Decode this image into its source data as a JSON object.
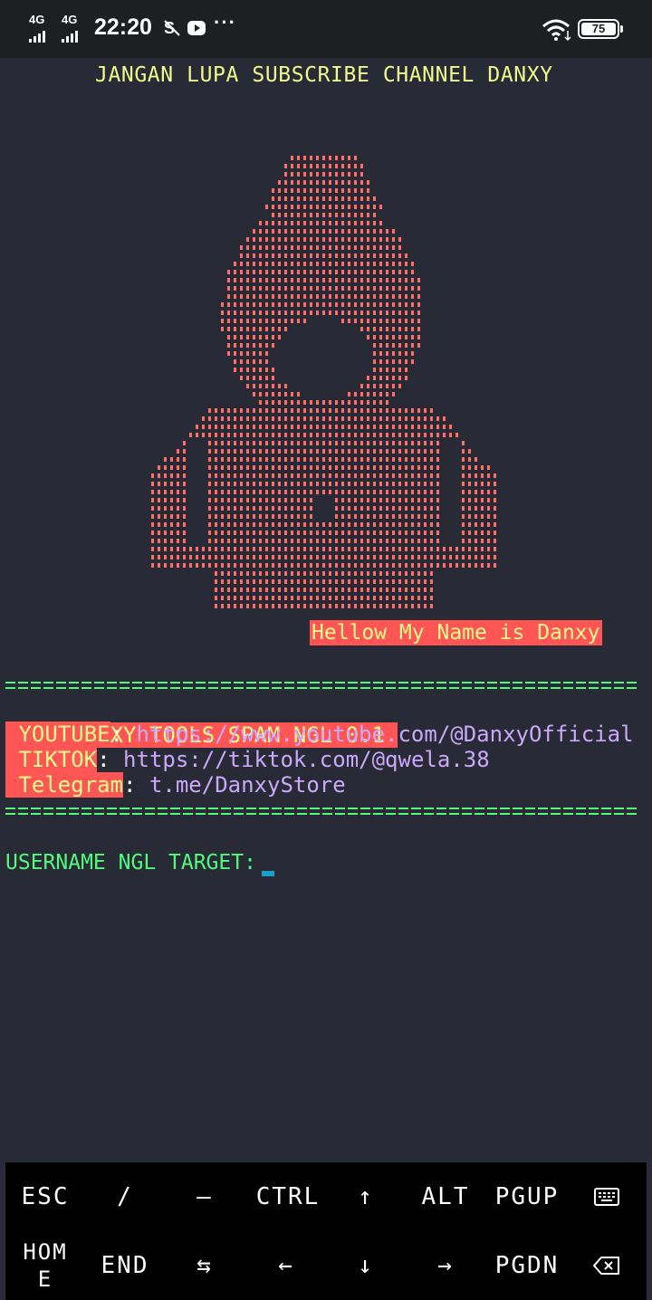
{
  "status_bar": {
    "network1": "4G",
    "network2": "4G",
    "time": "22:20",
    "more": "···",
    "battery": "75"
  },
  "terminal": {
    "banner": "JANGAN LUPA SUBSCRIBE CHANNEL DANXY",
    "hello": "Hellow My Name is Danxy",
    "tool_title": " DANXY TOOLS SPAM NGL 0.1 ",
    "youtube_label": " YOUTUBE",
    "youtube_url": " https://www.youtube.com/@DanxyOfficial",
    "tiktok_label": " TIKTOK",
    "tiktok_url": " https://tiktok.com/@qwela.38",
    "telegram_label": " Telegram",
    "telegram_url": " t.me/DanxyStore",
    "colon": ":",
    "prompt": "USERNAME NGL TARGET:"
  },
  "colors": {
    "background": "#282a36",
    "art": "#ff6e67",
    "highlight": "#ff5555",
    "yellow": "#f1fa8c",
    "green": "#50fa7b",
    "purple": "#caa9fa",
    "cursor": "#1aa0c8"
  },
  "extra_keys": {
    "row1": [
      "ESC",
      "/",
      "—",
      "CTRL",
      "↑",
      "ALT",
      "PGUP"
    ],
    "row2": [
      "HOM\nE",
      "END",
      "⇆",
      "←",
      "↓",
      "→",
      "PGDN"
    ],
    "icons": [
      "keyboard-icon",
      "backspace-icon"
    ]
  }
}
